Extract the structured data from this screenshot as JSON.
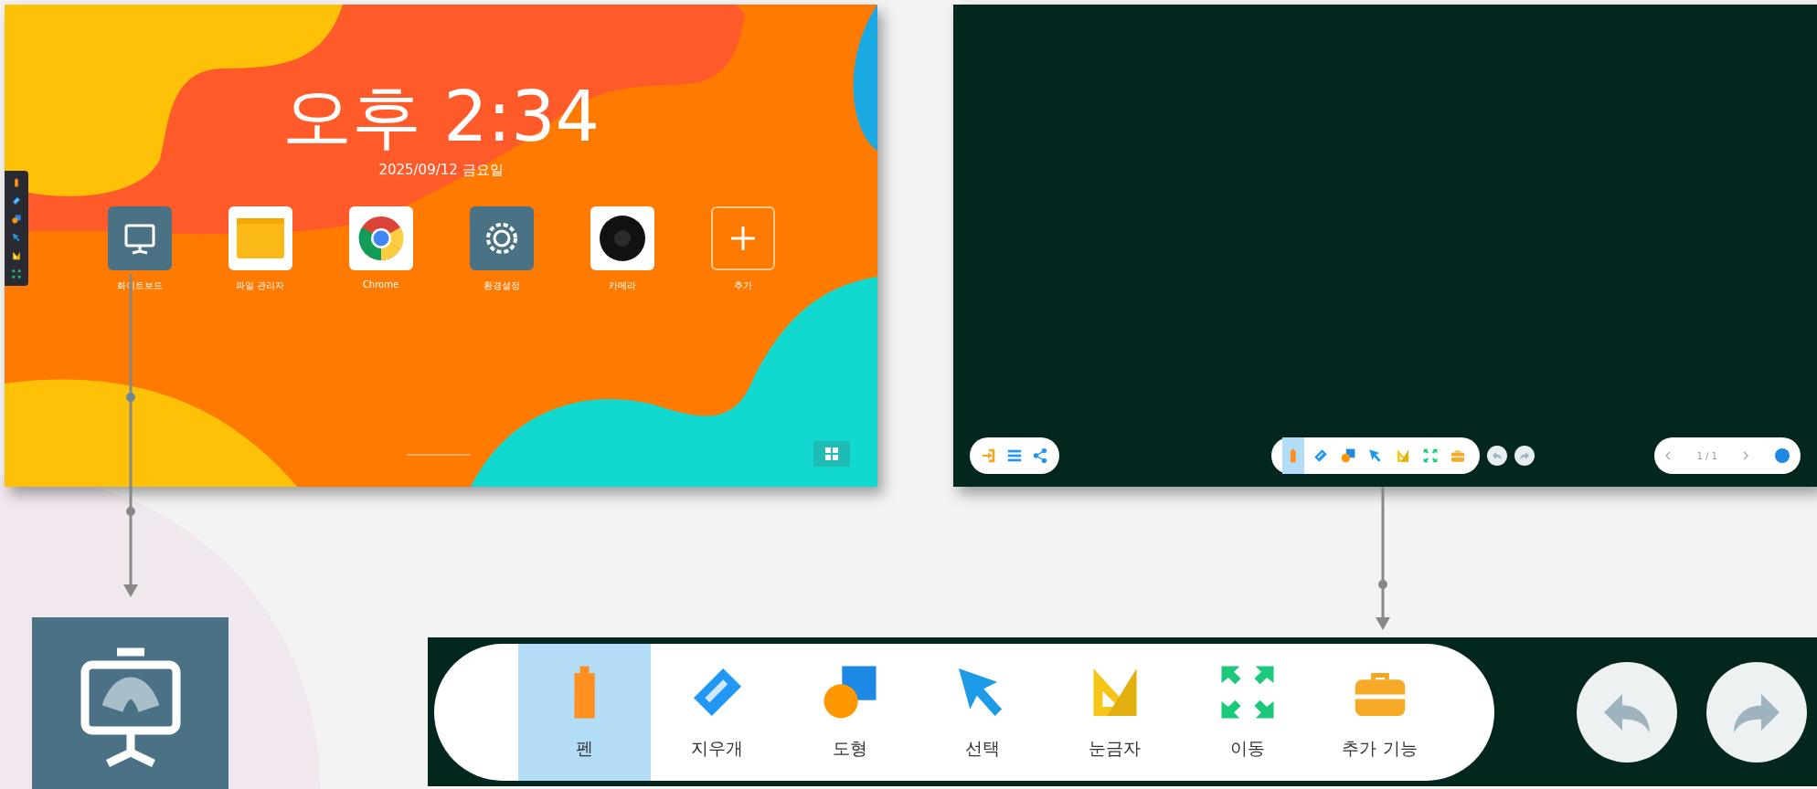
{
  "home_screen": {
    "clock": "오후 2:34",
    "date": "2025/09/12  금요일",
    "side_tools": [
      {
        "kind": "pen"
      },
      {
        "kind": "eraser"
      },
      {
        "kind": "shape"
      },
      {
        "kind": "select"
      },
      {
        "kind": "ruler"
      },
      {
        "kind": "move"
      }
    ],
    "apps": [
      {
        "label": "화이트보드",
        "kind": "whiteboard"
      },
      {
        "label": "파일 관리자",
        "kind": "files"
      },
      {
        "label": "Chrome",
        "kind": "browser"
      },
      {
        "label": "환경설정",
        "kind": "settings"
      },
      {
        "label": "카메라",
        "kind": "camera"
      },
      {
        "label": "추가",
        "kind": "add"
      }
    ]
  },
  "whiteboard_screen": {
    "left_tools": [
      {
        "kind": "exit"
      },
      {
        "kind": "menu"
      },
      {
        "kind": "share"
      }
    ],
    "tools": [
      {
        "kind": "pen",
        "selected": true
      },
      {
        "kind": "eraser",
        "selected": false
      },
      {
        "kind": "shape",
        "selected": false
      },
      {
        "kind": "select",
        "selected": false
      },
      {
        "kind": "ruler",
        "selected": false
      },
      {
        "kind": "move",
        "selected": false
      },
      {
        "kind": "toolbox",
        "selected": false
      }
    ],
    "page_indicator": "1 / 1"
  },
  "toolbar_detail": {
    "tools": [
      {
        "label": "펜",
        "kind": "pen",
        "selected": true
      },
      {
        "label": "지우개",
        "kind": "eraser",
        "selected": false
      },
      {
        "label": "도형",
        "kind": "shape",
        "selected": false
      },
      {
        "label": "선택",
        "kind": "select",
        "selected": false
      },
      {
        "label": "눈금자",
        "kind": "ruler",
        "selected": false
      },
      {
        "label": "이동",
        "kind": "move",
        "selected": false
      },
      {
        "label": "추가 기능",
        "kind": "toolbox",
        "selected": false
      }
    ]
  }
}
